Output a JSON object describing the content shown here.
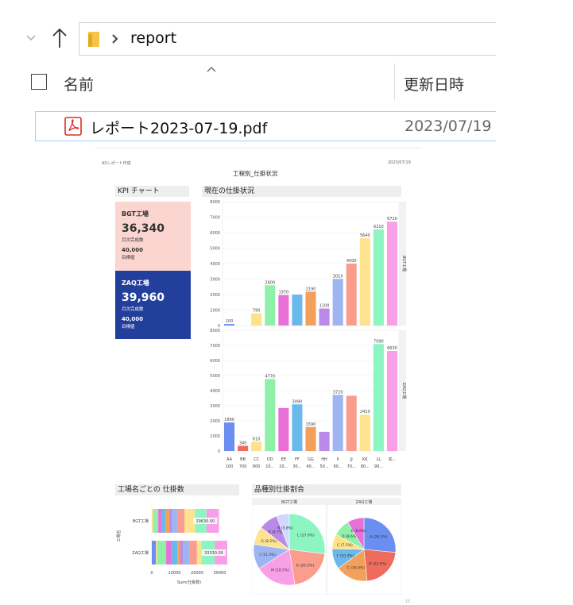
{
  "explorer": {
    "breadcrumb_folder": "report",
    "columns": {
      "name": "名前",
      "modified": "更新日時"
    },
    "file": {
      "name": "レポート2023-07-19.pdf",
      "date": "2023/07/19"
    },
    "icons": [
      "chevron-down-icon",
      "up-arrow-icon",
      "folder-icon",
      "chevron-right-icon",
      "pdf-icon"
    ]
  },
  "preview": {
    "header_left": "ASレポート作成",
    "header_right": "2023/07/19",
    "title": "工程別_仕掛状況",
    "kpi_section": "KPI チャート",
    "main_section": "現在の仕掛状況",
    "kpis": [
      {
        "name": "BGT工場",
        "value": "36,340",
        "value_label": "月次完成数",
        "target": "40,000",
        "target_label": "目標値"
      },
      {
        "name": "ZAQ工場",
        "value": "39,960",
        "value_label": "月次完成数",
        "target": "40,000",
        "target_label": "目標値"
      }
    ],
    "bottom_left_section": "工場名ごとの 仕掛数",
    "bottom_right_section": "品種別仕掛割合",
    "page_num": "10"
  },
  "chart_data": [
    {
      "type": "bar",
      "title": "現在の仕掛状況",
      "categories": [
        "AA",
        "BB",
        "CC",
        "DD",
        "EE",
        "FF",
        "GG",
        "HH",
        "II",
        "JJ",
        "KK",
        "LL",
        "完..."
      ],
      "category_sublabels": [
        "100",
        "700",
        "800",
        "10...",
        "20...",
        "30...",
        "40...",
        "50...",
        "60...",
        "70...",
        "80...",
        "99..."
      ],
      "colors": [
        "#6b8ff0",
        "#ef6b5b",
        "#fde28a",
        "#8ff0a8",
        "#e870d8",
        "#6ab8ec",
        "#f2a05a",
        "#b98ae8",
        "#9fb5f2",
        "#fb9d8c",
        "#fde38f",
        "#8df5c2",
        "#f89fe8"
      ],
      "facets": [
        {
          "name": "BGT工場",
          "values": [
            100,
            0,
            790,
            2600,
            1970,
            2000,
            2190,
            1100,
            3010,
            4000,
            5640,
            6210,
            6710
          ],
          "labels": [
            "100",
            "",
            "790",
            "2600",
            "1970",
            "",
            "2190",
            "1100",
            "3010",
            "4000",
            "5640",
            "6210",
            "6710"
          ]
        },
        {
          "name": "ZAQ工場",
          "values": [
            1890,
            340,
            610,
            4770,
            2850,
            3090,
            1590,
            1270,
            3720,
            3660,
            2410,
            7090,
            6630
          ],
          "labels": [
            "1890",
            "340",
            "610",
            "4770",
            "",
            "3090",
            "1590",
            "",
            "3720",
            "",
            "2410",
            "7090",
            "6630"
          ]
        }
      ],
      "yticks": [
        "0",
        "1000",
        "2000",
        "3000",
        "4000",
        "5000",
        "6000",
        "7000",
        "8000"
      ],
      "ylim": [
        0,
        8000
      ]
    },
    {
      "type": "bar",
      "orientation": "horizontal",
      "title": "工場名ごとの 仕掛数",
      "categories": [
        "BGT工場",
        "ZAQ工場"
      ],
      "values": [
        29630,
        33330
      ],
      "labels": [
        "29630.00",
        "33330.00"
      ],
      "ylabel": "工場名",
      "xlabel": "Sum(仕掛数)",
      "xticks": [
        "0",
        "10000",
        "20000",
        "30000"
      ],
      "xlim": [
        0,
        33000
      ]
    },
    {
      "type": "pie",
      "title": "品種別仕掛割合",
      "facets": [
        {
          "name": "BGT工場",
          "slices": [
            {
              "label": "L (27.0%)",
              "value": 27.0,
              "color": "#8df5c2"
            },
            {
              "label": "K (20.5%)",
              "value": 20.5,
              "color": "#fb9d8c"
            },
            {
              "label": "M (18.5%)",
              "value": 18.5,
              "color": "#f89fe8"
            },
            {
              "label": "I (11.3%)",
              "value": 11.3,
              "color": "#9fb5f2"
            },
            {
              "label": "G (8.2%)",
              "value": 8.2,
              "color": "#fde38f"
            },
            {
              "label": "K (8.7%)",
              "value": 8.7,
              "color": "#b98ae8"
            },
            {
              "label": "N (5.8%)",
              "value": 5.8,
              "color": "#cfd8ff"
            }
          ]
        },
        {
          "name": "ZAQ工場",
          "slices": [
            {
              "label": "A (26.5%)",
              "value": 26.5,
              "color": "#6b8ff0"
            },
            {
              "label": "B (22.0%)",
              "value": 22.0,
              "color": "#ef6b5b"
            },
            {
              "label": "C (16.4%)",
              "value": 16.4,
              "color": "#f2a05a"
            },
            {
              "label": "F (10.4%)",
              "value": 10.4,
              "color": "#6ab8ec"
            },
            {
              "label": "C (7.5%)",
              "value": 7.5,
              "color": "#fde28a"
            },
            {
              "label": "D (8.6%)",
              "value": 8.6,
              "color": "#8ff0a8"
            },
            {
              "label": "E (8.6%)",
              "value": 8.6,
              "color": "#e870d8"
            }
          ]
        }
      ]
    }
  ]
}
